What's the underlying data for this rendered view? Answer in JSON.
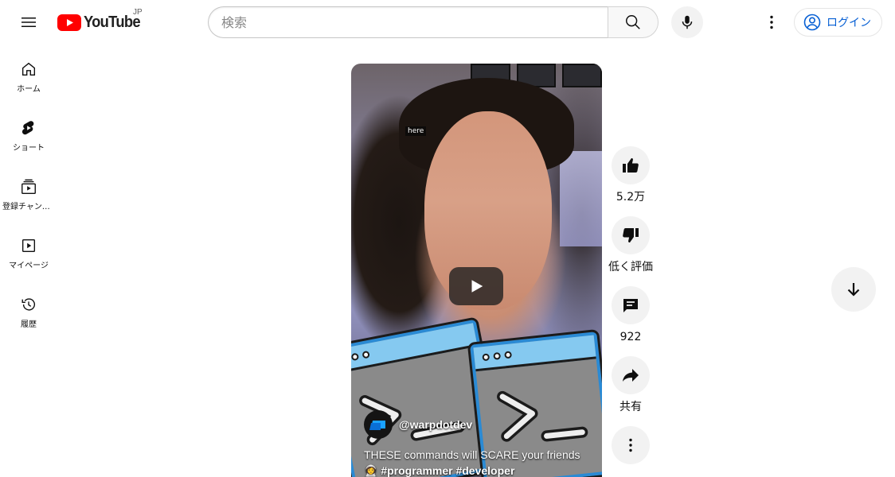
{
  "header": {
    "logo_text": "YouTube",
    "region": "JP",
    "search_placeholder": "検索",
    "signin_label": "ログイン",
    "icons": [
      "menu-icon",
      "youtube-logo-icon",
      "search-icon",
      "microphone-icon",
      "more-vert-icon",
      "account-icon"
    ],
    "accent_color": "#065fd4",
    "brand_color": "#ff0000"
  },
  "guide": {
    "items": [
      {
        "label": "ホーム",
        "icon": "home-icon"
      },
      {
        "label": "ショート",
        "icon": "shorts-icon"
      },
      {
        "label": "登録チャンネル",
        "icon": "subscriptions-icon"
      },
      {
        "label": "マイページ",
        "icon": "library-icon"
      },
      {
        "label": "履歴",
        "icon": "history-icon"
      }
    ]
  },
  "short": {
    "caption_word": "here",
    "channel_handle": "@warpdotdev",
    "title_line1": "THESE commands will SCARE your friends",
    "title_emoji": "👩‍🚀",
    "hashtags": "#programmer #developer"
  },
  "actions": {
    "like_count": "5.2万",
    "dislike_label": "低く評価",
    "comment_count": "922",
    "share_label": "共有"
  }
}
